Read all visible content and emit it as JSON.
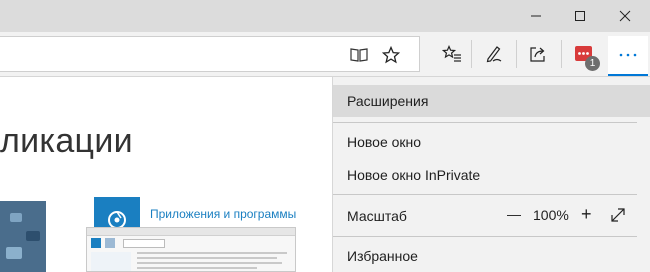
{
  "window": {
    "controls": [
      "minimize",
      "maximize",
      "close"
    ]
  },
  "toolbar": {
    "icons": [
      "reading-view-icon",
      "favorite-star-icon",
      "favorites-hub-icon",
      "web-note-icon",
      "share-icon",
      "extension-icon",
      "more-icon"
    ],
    "extension_badge": "1",
    "accent_color": "#0078d7"
  },
  "page": {
    "title": "ликации",
    "app_link": "Приложения и программы"
  },
  "menu": {
    "items": [
      {
        "label": "Расширения",
        "active": true
      },
      {
        "label": "Новое окно"
      },
      {
        "label": "Новое окно InPrivate"
      },
      {
        "label": "Масштаб"
      },
      {
        "label": "Избранное"
      }
    ],
    "zoom": {
      "value": "100%",
      "minus": "—",
      "plus": "+"
    }
  }
}
